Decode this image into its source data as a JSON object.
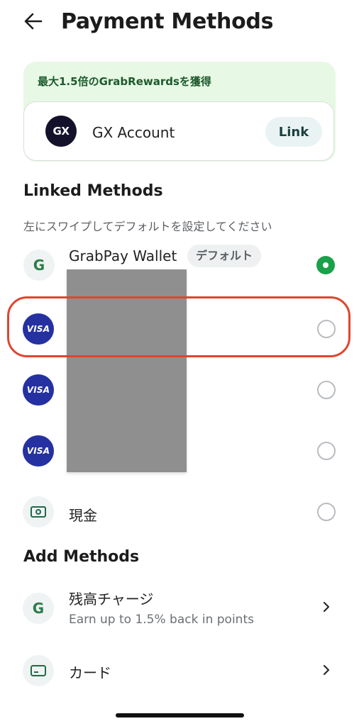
{
  "header": {
    "title": "Payment Methods",
    "back_icon": "arrow-left-icon"
  },
  "promo": {
    "text": "最大1.5倍のGrabRewardsを獲得",
    "account": {
      "logo_text": "GX",
      "name": "GX Account",
      "link_label": "Link"
    }
  },
  "linked": {
    "title": "Linked Methods",
    "hint": "左にスワイプしてデフォルトを設定してください",
    "items": [
      {
        "icon": "grab-g-icon",
        "icon_text": "G",
        "label": "GrabPay Wallet",
        "badge": "デフォルト",
        "selected": true
      },
      {
        "icon": "visa-icon",
        "icon_text": "VISA",
        "label": "",
        "selected": false
      },
      {
        "icon": "visa-icon",
        "icon_text": "VISA",
        "label": "",
        "selected": false
      },
      {
        "icon": "visa-icon",
        "icon_text": "VISA",
        "label": "",
        "selected": false
      },
      {
        "icon": "cash-icon",
        "label": "現金",
        "selected": false
      }
    ]
  },
  "add": {
    "title": "Add Methods",
    "items": [
      {
        "icon": "grab-g-icon",
        "icon_text": "G",
        "label": "残高チャージ",
        "sub": "Earn up to 1.5% back in points"
      },
      {
        "icon": "card-icon",
        "label": "カード"
      }
    ]
  },
  "colors": {
    "accent_green": "#1aa14a",
    "visa_blue": "#2531a0",
    "highlight_red": "#e0452f",
    "promo_bg": "#e7f8e4"
  }
}
